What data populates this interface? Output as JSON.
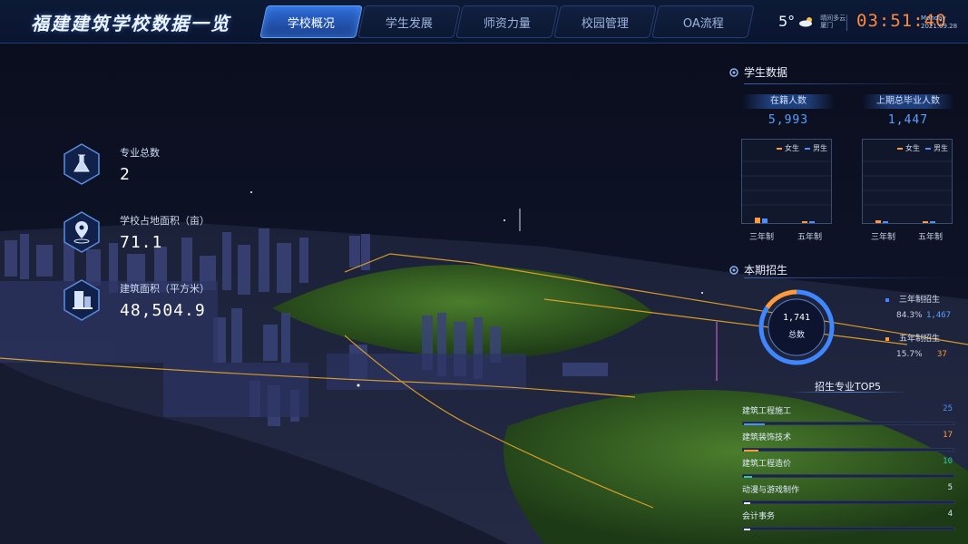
{
  "header": {
    "title": "福建建筑学校数据一览",
    "tabs": [
      {
        "label": "学校概况",
        "active": true
      },
      {
        "label": "学生发展",
        "active": false
      },
      {
        "label": "师资力量",
        "active": false
      },
      {
        "label": "校园管理",
        "active": false
      },
      {
        "label": "OA流程",
        "active": false
      }
    ],
    "weather": {
      "temp": "5°",
      "condition_icon": "cloud-sun-icon",
      "loc_line1": "晴间多云",
      "loc_line2": "厦门"
    },
    "clock": "03:51:40",
    "weekday": "Monday",
    "date": "2021.09.28"
  },
  "stats": [
    {
      "icon": "lab-flask-icon",
      "label": "专业总数",
      "value": "2"
    },
    {
      "icon": "location-pin-icon",
      "label": "学校占地面积（亩）",
      "value": "71.1"
    },
    {
      "icon": "building-icon",
      "label": "建筑面积（平方米）",
      "value": "48,504.9"
    }
  ],
  "student_data": {
    "title": "学生数据",
    "enrolled_label": "在籍人数",
    "enrolled_value": "5,993",
    "graduates_label": "上期总毕业人数",
    "graduates_value": "1,447",
    "legend_female": "女生",
    "legend_male": "男生",
    "categories": [
      "三年制",
      "五年制"
    ]
  },
  "enrollment": {
    "title": "本期招生",
    "total": "1,741",
    "total_label": "总数",
    "three_year": {
      "label": "三年制招生",
      "pct": "84.3%",
      "count": "1,467"
    },
    "five_year": {
      "label": "五年制招生",
      "pct": "15.7%",
      "count": "37"
    }
  },
  "tops": {
    "title": "招生专业TOP5",
    "items": [
      {
        "name": "建筑工程施工",
        "value": 25,
        "label": "25",
        "color": "#4d8fff"
      },
      {
        "name": "建筑装饰技术",
        "value": 17,
        "label": "17",
        "color": "#ff9a3c"
      },
      {
        "name": "建筑工程造价",
        "value": 10,
        "label": "10",
        "color": "#34c3b0"
      },
      {
        "name": "动漫与游戏制作",
        "value": 5,
        "label": "5",
        "color": "#e6ecf8"
      },
      {
        "name": "会计事务",
        "value": 4,
        "label": "4",
        "color": "#e6ecf8"
      }
    ]
  },
  "colors": {
    "accent": "#4d8fff",
    "orange": "#ff9a3c",
    "teal": "#34c3b0",
    "bg": "#0a0d1c"
  }
}
